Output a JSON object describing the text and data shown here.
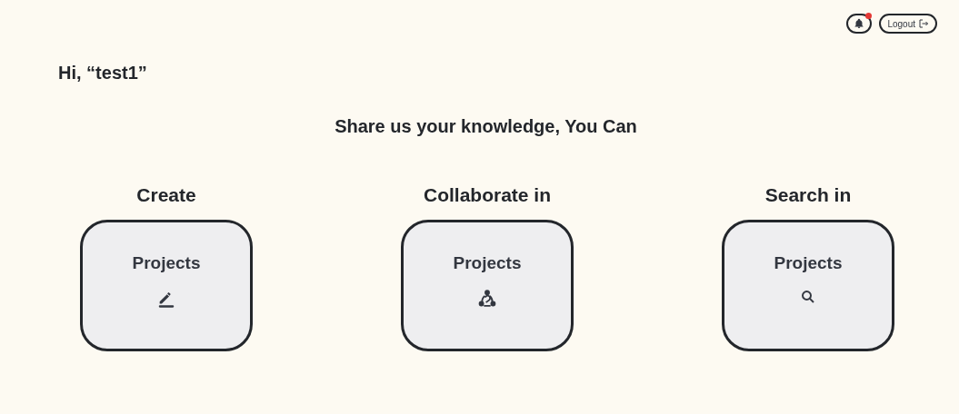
{
  "header": {
    "notifications": {
      "unread": true
    },
    "logout": {
      "label": "Logout"
    }
  },
  "greeting": "Hi, “test1”",
  "tagline": "Share us your knowledge, You Can",
  "actions": [
    {
      "heading": "Create",
      "card_label": "Projects",
      "kind": "create"
    },
    {
      "heading": "Collaborate in",
      "card_label": "Projects",
      "kind": "collaborate"
    },
    {
      "heading": "Search in",
      "card_label": "Projects",
      "kind": "search"
    }
  ]
}
